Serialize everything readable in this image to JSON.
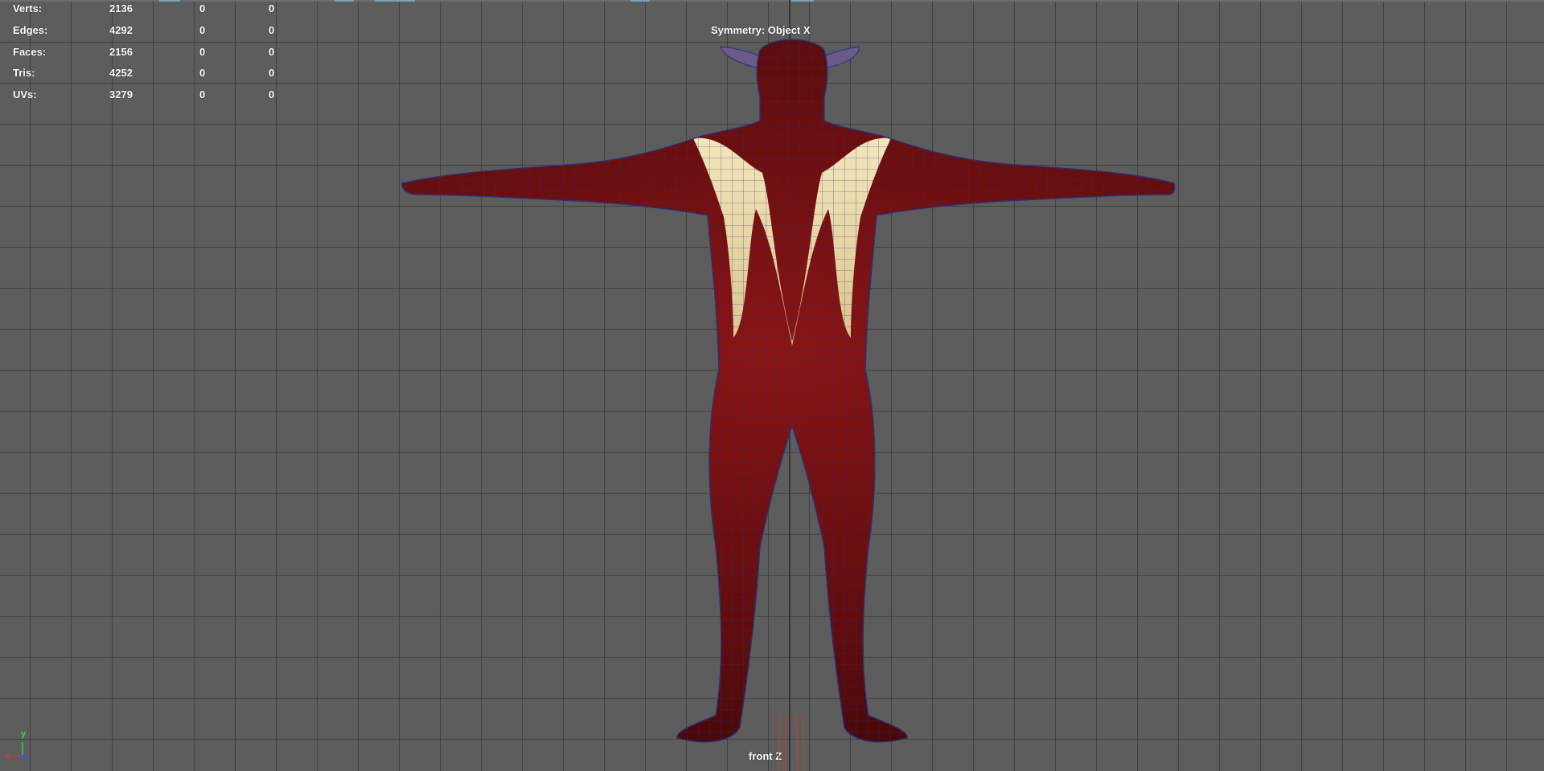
{
  "hud": {
    "rows": [
      {
        "label": "Verts:",
        "c1": "2136",
        "c2": "0",
        "c3": "0"
      },
      {
        "label": "Edges:",
        "c1": "4292",
        "c2": "0",
        "c3": "0"
      },
      {
        "label": "Faces:",
        "c1": "2156",
        "c2": "0",
        "c3": "0"
      },
      {
        "label": "Tris:",
        "c1": "4252",
        "c2": "0",
        "c3": "0"
      },
      {
        "label": "UVs:",
        "c1": "3279",
        "c2": "0",
        "c3": "0"
      }
    ]
  },
  "viewport": {
    "symmetry_text": "Symmetry: Object X",
    "camera_label": "front Z",
    "axis": {
      "x": "x",
      "y": "y",
      "z": "z"
    }
  },
  "colors": {
    "background": "#5d5d5d",
    "grid_line": "#3c3c3c",
    "skin_red": "#6b0d0d",
    "skin_cream": "#e8d8a6",
    "wire": "#2a2f7a",
    "axis_x": "#d23a3a",
    "axis_y": "#3ad23a",
    "axis_z": "#3a5ad2"
  },
  "icons": [
    "axis-gizmo-icon"
  ]
}
